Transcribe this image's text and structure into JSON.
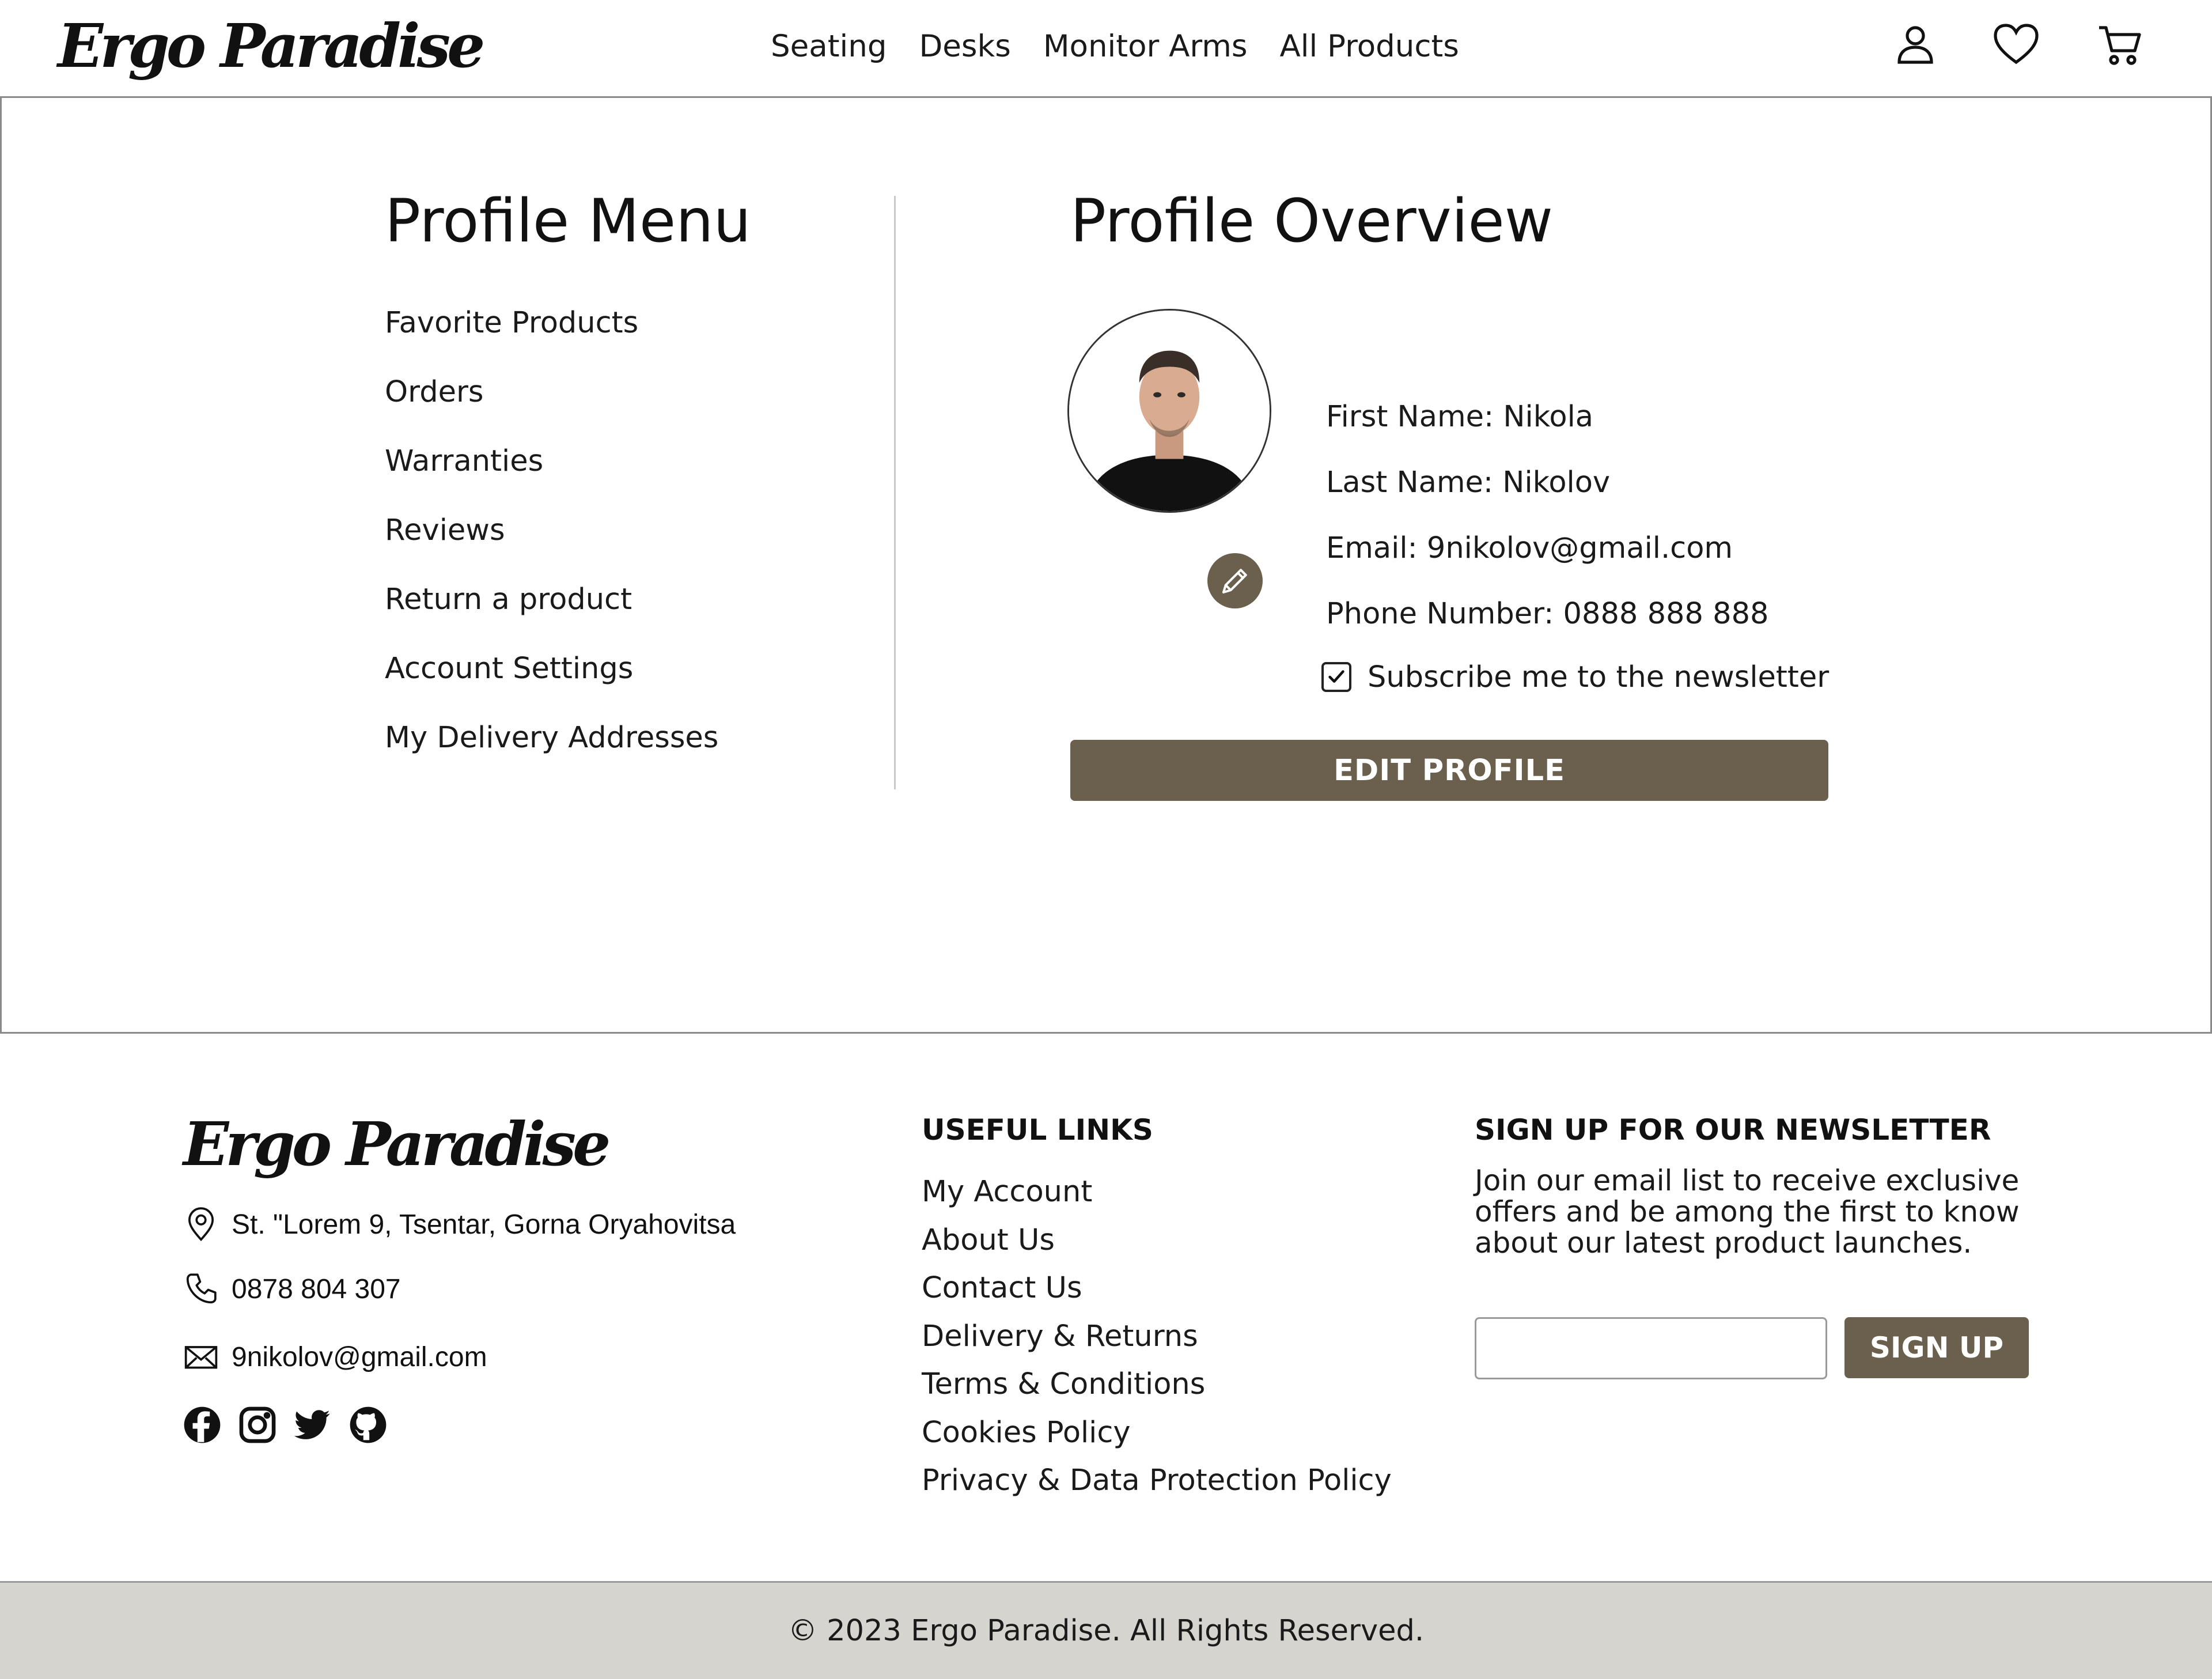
{
  "header": {
    "logo": "Ergo Paradise",
    "nav": [
      "Seating",
      "Desks",
      "Monitor Arms",
      "All Products"
    ],
    "icons": [
      "user-icon",
      "heart-icon",
      "cart-icon"
    ]
  },
  "menu": {
    "title": "Profile Menu",
    "items": [
      "Favorite Products",
      "Orders",
      "Warranties",
      "Reviews",
      "Return a product",
      "Account Settings",
      "My Delivery Addresses"
    ]
  },
  "overview": {
    "title": "Profile Overview",
    "first_name": "First Name: Nikola",
    "last_name": "Last Name: Nikolov",
    "email": "Email: 9nikolov@gmail.com",
    "phone": "Phone Number: 0888 888 888",
    "newsletter_label": "Subscribe me to the newsletter",
    "newsletter_checked": true,
    "edit_button": "EDIT PROFILE"
  },
  "footer": {
    "logo": "Ergo Paradise",
    "address": "St. \"Lorem 9, Tsentar, Gorna Oryahovitsa",
    "phone": "0878 804 307",
    "email": "9nikolov@gmail.com",
    "social": [
      "facebook-icon",
      "instagram-icon",
      "twitter-icon",
      "github-icon"
    ],
    "links_title": "USEFUL LINKS",
    "links": [
      "My Account",
      "About Us",
      "Contact Us",
      "Delivery & Returns",
      "Terms & Conditions",
      "Cookies Policy",
      "Privacy & Data Protection Policy"
    ],
    "newsletter_title": "SIGN UP FOR OUR NEWSLETTER",
    "newsletter_text": "Join our email list to receive exclusive offers and be among the first to know about our latest product launches.",
    "signup_button": "SIGN UP",
    "copyright": "© 2023 Ergo Paradise. All Rights Reserved."
  },
  "colors": {
    "accent": "#6b604e",
    "bottom_bar": "#d5d4cf"
  }
}
